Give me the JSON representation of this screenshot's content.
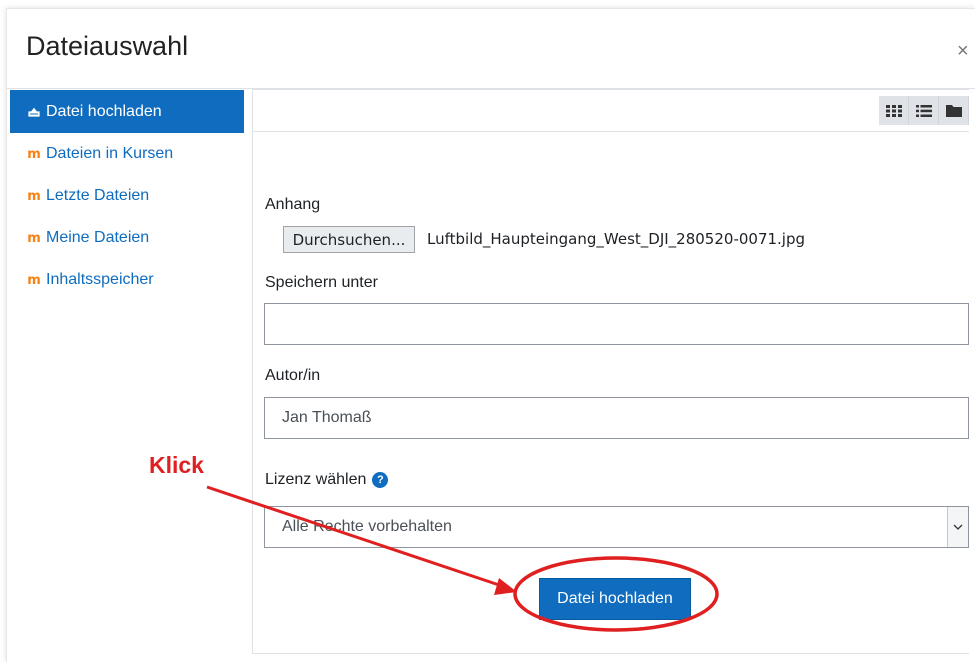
{
  "dialog": {
    "title": "Dateiauswahl",
    "close_label": "×"
  },
  "sidebar": {
    "items": [
      {
        "label": "Datei hochladen",
        "icon": "upload-icon",
        "active": true
      },
      {
        "label": "Dateien in Kursen",
        "icon": "moodle-icon"
      },
      {
        "label": "Letzte Dateien",
        "icon": "moodle-icon"
      },
      {
        "label": "Meine Dateien",
        "icon": "moodle-icon"
      },
      {
        "label": "Inhaltsspeicher",
        "icon": "moodle-icon"
      }
    ]
  },
  "toolbar": {
    "icons": [
      "grid-view-icon",
      "list-view-icon",
      "folder-view-icon"
    ]
  },
  "form": {
    "attachment_label": "Anhang",
    "browse_label": "Durchsuchen...",
    "file_name": "Luftbild_Haupteingang_West_DJI_280520-0071.jpg",
    "save_as_label": "Speichern unter",
    "save_as_value": "",
    "author_label": "Autor/in",
    "author_value": "Jan Thomaß",
    "license_label": "Lizenz wählen",
    "license_value": "Alle Rechte vorbehalten",
    "upload_button": "Datei hochladen"
  },
  "annotation": {
    "text": "Klick",
    "color": "#e02020"
  },
  "colors": {
    "accent": "#0f6cbf",
    "moodle_orange": "#f98012"
  }
}
